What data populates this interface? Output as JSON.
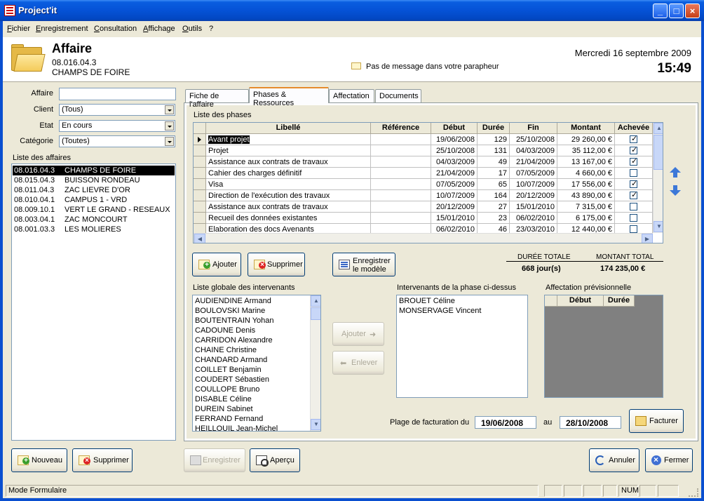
{
  "window": {
    "title": "Project'it"
  },
  "menu": [
    "Fichier",
    "Enregistrement",
    "Consultation",
    "Affichage",
    "Outils",
    "?"
  ],
  "header": {
    "title": "Affaire",
    "code": "08.016.04.3",
    "name": "CHAMPS DE FOIRE",
    "message": "Pas de message dans votre parapheur",
    "date": "Mercredi 16 septembre 2009",
    "time": "15:49"
  },
  "filters": {
    "affaire_label": "Affaire",
    "affaire_value": "",
    "client_label": "Client",
    "client_value": "(Tous)",
    "etat_label": "Etat",
    "etat_value": "En cours",
    "categorie_label": "Catégorie",
    "categorie_value": "(Toutes)"
  },
  "affaires": {
    "title": "Liste des affaires",
    "rows": [
      {
        "code": "08.016.04.3",
        "name": "CHAMPS DE FOIRE",
        "selected": true
      },
      {
        "code": "08.015.04.3",
        "name": "BUISSON RONDEAU"
      },
      {
        "code": "08.011.04.3",
        "name": "ZAC LIEVRE D'OR"
      },
      {
        "code": "08.010.04.1",
        "name": "CAMPUS 1 - VRD"
      },
      {
        "code": "08.009.10.1",
        "name": "VERT LE GRAND - RESEAUX"
      },
      {
        "code": "08.003.04.1",
        "name": "ZAC MONCOURT"
      },
      {
        "code": "08.001.03.3",
        "name": "LES MOLIERES"
      }
    ]
  },
  "tabs": [
    "Fiche de l'affaire",
    "Phases & Ressources",
    "Affectation",
    "Documents"
  ],
  "phases": {
    "title": "Liste des phases",
    "columns": [
      "Libellé",
      "Référence",
      "Début",
      "Durée",
      "Fin",
      "Montant",
      "Achevée"
    ],
    "rows": [
      {
        "libelle": "Avant projet",
        "reference": "",
        "debut": "19/06/2008",
        "duree": "129",
        "fin": "25/10/2008",
        "montant": "29 260,00 €",
        "achevee": true
      },
      {
        "libelle": "Projet",
        "reference": "",
        "debut": "25/10/2008",
        "duree": "131",
        "fin": "04/03/2009",
        "montant": "35 112,00 €",
        "achevee": true
      },
      {
        "libelle": "Assistance aux contrats de travaux",
        "reference": "",
        "debut": "04/03/2009",
        "duree": "49",
        "fin": "21/04/2009",
        "montant": "13 167,00 €",
        "achevee": true
      },
      {
        "libelle": "Cahier des charges définitif",
        "reference": "",
        "debut": "21/04/2009",
        "duree": "17",
        "fin": "07/05/2009",
        "montant": "4 660,00 €",
        "achevee": false
      },
      {
        "libelle": "Visa",
        "reference": "",
        "debut": "07/05/2009",
        "duree": "65",
        "fin": "10/07/2009",
        "montant": "17 556,00 €",
        "achevee": true
      },
      {
        "libelle": "Direction de l'exécution des travaux",
        "reference": "",
        "debut": "10/07/2009",
        "duree": "164",
        "fin": "20/12/2009",
        "montant": "43 890,00 €",
        "achevee": true
      },
      {
        "libelle": "Assistance aux contrats de travaux",
        "reference": "",
        "debut": "20/12/2009",
        "duree": "27",
        "fin": "15/01/2010",
        "montant": "7 315,00 €",
        "achevee": false
      },
      {
        "libelle": "Recueil des données existantes",
        "reference": "",
        "debut": "15/01/2010",
        "duree": "23",
        "fin": "06/02/2010",
        "montant": "6 175,00 €",
        "achevee": false
      },
      {
        "libelle": "Elaboration des docs Avenants",
        "reference": "",
        "debut": "06/02/2010",
        "duree": "46",
        "fin": "23/03/2010",
        "montant": "12 440,00 €",
        "achevee": false
      }
    ]
  },
  "phase_buttons": {
    "ajouter": "Ajouter",
    "supprimer": "Supprimer",
    "enregistrer_modele_1": "Enregistrer",
    "enregistrer_modele_2": "le modèle"
  },
  "totals": {
    "duree_label": "DURÉE TOTALE",
    "duree_value": "668 jour(s)",
    "montant_label": "MONTANT TOTAL",
    "montant_value": "174 235,00 €"
  },
  "intervenants": {
    "global_title": "Liste globale des intervenants",
    "global": [
      "AUDIENDINE Armand",
      "BOULOVSKI Marine",
      "BOUTENTRAIN Yohan",
      "CADOUNE Denis",
      "CARRIDON Alexandre",
      "CHAINE Christine",
      "CHANDARD Armand",
      "COILLET Benjamin",
      "COUDERT Sébastien",
      "COULLOPE Bruno",
      "DISABLE Céline",
      "DUREIN Sabinet",
      "FERRAND Fernand",
      "HEILLOUIL Jean-Michel"
    ],
    "phase_title": "Intervenants de la phase ci-dessus",
    "phase": [
      "BROUET Céline",
      "MONSERVAGE Vincent"
    ],
    "ajouter": "Ajouter",
    "enlever": "Enlever"
  },
  "affectation": {
    "title": "Affectation prévisionnelle",
    "col_debut": "Début",
    "col_duree": "Durée"
  },
  "facturation": {
    "label": "Plage de facturation du",
    "from": "19/06/2008",
    "au": "au",
    "to": "28/10/2008",
    "button": "Facturer"
  },
  "bottom_buttons": {
    "nouveau": "Nouveau",
    "supprimer": "Supprimer",
    "enregistrer": "Enregistrer",
    "apercu": "Aperçu",
    "annuler": "Annuler",
    "fermer": "Fermer"
  },
  "status": {
    "mode": "Mode Formulaire",
    "num": "NUM"
  }
}
